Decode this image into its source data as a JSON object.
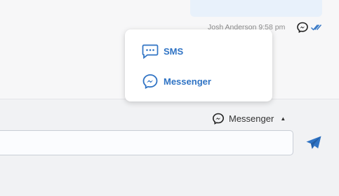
{
  "conversation": {
    "message_meta": "Josh Anderson 9:58 pm",
    "channel_icon": "messenger-icon",
    "status_icon": "double-check-icon"
  },
  "channel_menu": {
    "items": [
      {
        "label": "SMS",
        "icon": "sms-icon"
      },
      {
        "label": "Messenger",
        "icon": "messenger-icon"
      }
    ]
  },
  "composer": {
    "channel_label": "Messenger",
    "channel_icon": "messenger-icon",
    "caret_icon": "caret-up-icon",
    "input_value": "",
    "send_icon": "send-icon"
  },
  "colors": {
    "accent": "#2f73c4",
    "send": "#2f73c4",
    "bubble": "#e8f1fb"
  }
}
